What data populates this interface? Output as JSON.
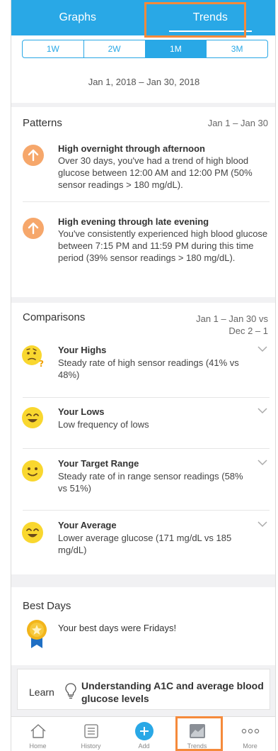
{
  "header": {
    "tabs": [
      {
        "label": "Graphs",
        "active": false
      },
      {
        "label": "Trends",
        "active": true
      }
    ]
  },
  "range": {
    "options": [
      "1W",
      "2W",
      "1M",
      "3M"
    ],
    "selected": "1M",
    "date_range": "Jan 1, 2018 – Jan 30, 2018"
  },
  "patterns": {
    "title": "Patterns",
    "date": "Jan 1 – Jan 30",
    "items": [
      {
        "title": "High overnight through afternoon",
        "description": "Over 30 days, you've had a trend of high blood glucose between 12:00 AM and 12:00 PM (50% sensor readings > 180 mg/dL).",
        "icon": "up-arrow-icon"
      },
      {
        "title": "High evening through late evening",
        "description": "You've consistently experienced high blood glucose between 7:15 PM and 11:59 PM during this time period (39% sensor readings > 180 mg/dL).",
        "icon": "up-arrow-icon"
      }
    ]
  },
  "comparisons": {
    "title": "Comparisons",
    "date_line1": "Jan 1 – Jan 30 vs",
    "date_line2": "Dec 2 – 1",
    "items": [
      {
        "title": "Your Highs",
        "description": "Steady rate of high sensor readings (41% vs 48%)",
        "icon": "thinking-face-icon"
      },
      {
        "title": "Your Lows",
        "description": "Low frequency of lows",
        "icon": "smiling-face-icon"
      },
      {
        "title": "Your Target Range",
        "description": "Steady rate of in range sensor readings (58% vs 51%)",
        "icon": "slight-smile-face-icon"
      },
      {
        "title": "Your Average",
        "description": "Lower average glucose (171 mg/dL vs 185 mg/dL)",
        "icon": "smiling-face-icon"
      }
    ]
  },
  "best_days": {
    "title": "Best Days",
    "text": "Your best days were Fridays!",
    "icon": "medal-icon"
  },
  "learn": {
    "label": "Learn",
    "text": "Understanding A1C and average blood glucose levels",
    "icon": "lightbulb-icon"
  },
  "tabbar": {
    "items": [
      {
        "label": "Home",
        "icon": "home-icon"
      },
      {
        "label": "History",
        "icon": "history-icon"
      },
      {
        "label": "Add",
        "icon": "add-icon"
      },
      {
        "label": "Trends",
        "icon": "trends-icon",
        "active": true
      },
      {
        "label": "More",
        "icon": "more-icon"
      }
    ]
  },
  "colors": {
    "accent": "#29a8e6",
    "highlight": "#f58a3b",
    "arrow": "#f6a76b",
    "face": "#f9d72f"
  }
}
